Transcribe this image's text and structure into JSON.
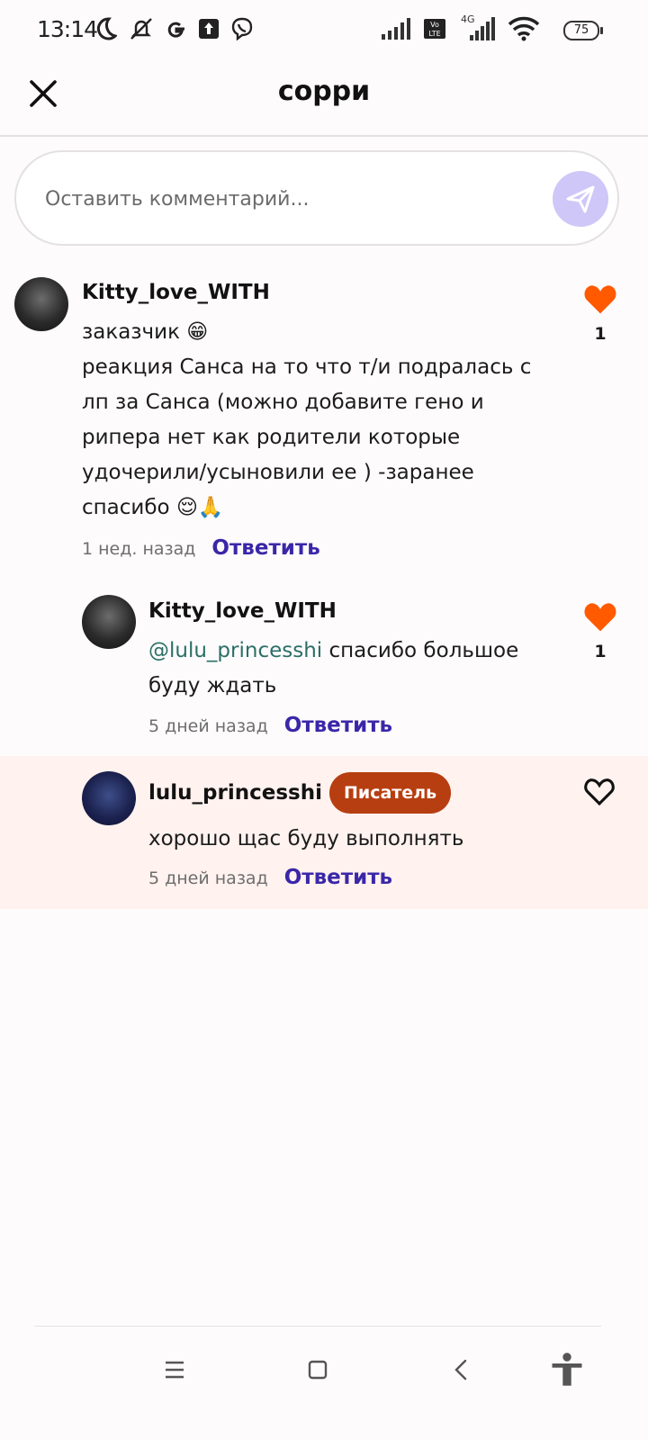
{
  "status_bar": {
    "time": "13:14",
    "battery": "75",
    "icons": [
      "moon-icon",
      "muted-bell-icon",
      "google-icon",
      "upload-icon",
      "viber-icon",
      "signal-icon",
      "volte-icon",
      "signal-4g-icon",
      "wifi-icon",
      "battery-icon"
    ],
    "network_label": "4G"
  },
  "header": {
    "title": "сорри"
  },
  "comment_input": {
    "placeholder": "Оставить комментарий..."
  },
  "comments": [
    {
      "username": "Kitty_love_WITH",
      "text": "заказчик 😁\nреакция Санса на то что т/и подралась с лп за Санса (можно добавите гено и рипера нет как родители которые удочерили/усыновили ее )  -заранее спасибо 😌🙏",
      "time": "1 нед. назад",
      "reply_label": "Ответить",
      "likes": "1",
      "liked": true
    },
    {
      "username": "Kitty_love_WITH",
      "mention": "@lulu_princesshi",
      "text": " спасибо большое буду ждать",
      "time": "5 дней назад",
      "reply_label": "Ответить",
      "likes": "1",
      "liked": true
    },
    {
      "username": "lulu_princesshi",
      "badge": "Писатель",
      "text": "хорошо щас буду выполнять",
      "time": "5 дней назад",
      "reply_label": "Ответить",
      "liked": false
    }
  ],
  "colors": {
    "accent_purple": "#3a27a8",
    "like_orange": "#ff5a00",
    "badge": "#b73e10",
    "send_button": "#cfc7f7",
    "highlight_bg": "#fff2ef"
  }
}
